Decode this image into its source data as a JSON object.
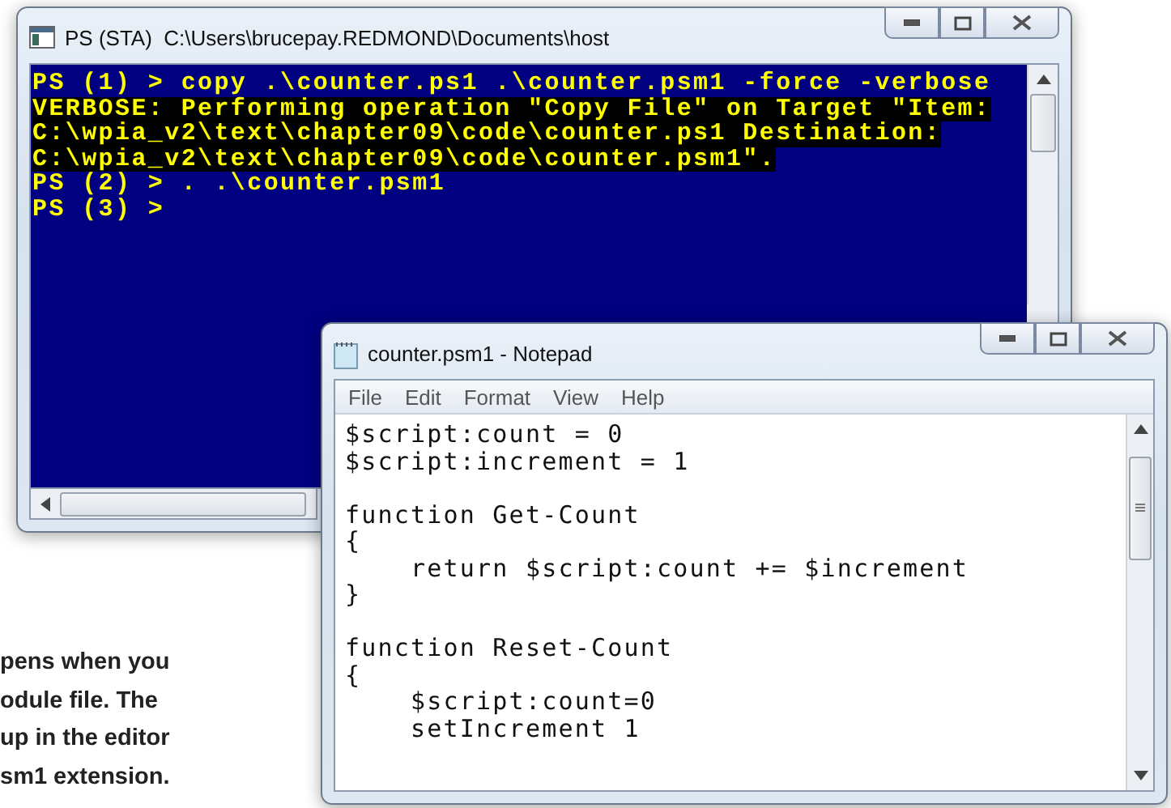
{
  "console_window": {
    "title": "PS (STA)  C:\\Users\\brucepay.REDMOND\\Documents\\host",
    "lines": [
      {
        "text": "PS (1) > copy .\\counter.ps1 .\\counter.psm1 -force -verbose",
        "kind": "prompt"
      },
      {
        "text": "VERBOSE: Performing operation \"Copy File\" on Target \"Item:",
        "kind": "verbose"
      },
      {
        "text": "C:\\wpia_v2\\text\\chapter09\\code\\counter.ps1 Destination:",
        "kind": "verbose"
      },
      {
        "text": "C:\\wpia_v2\\text\\chapter09\\code\\counter.psm1\".",
        "kind": "verbose"
      },
      {
        "text": "PS (2) > . .\\counter.psm1",
        "kind": "prompt"
      },
      {
        "text": "PS (3) >",
        "kind": "prompt"
      }
    ]
  },
  "notepad_window": {
    "title": "counter.psm1 - Notepad",
    "menu": [
      "File",
      "Edit",
      "Format",
      "View",
      "Help"
    ],
    "blocks": [
      [
        "$script:count = 0",
        "$script:increment = 1"
      ],
      [
        "function Get-Count",
        "{",
        "    return $script:count += $increment",
        "}"
      ],
      [
        "function Reset-Count",
        "{",
        "    $script:count=0",
        "    setIncrement 1"
      ]
    ]
  },
  "caption": {
    "lines": [
      "pens when you",
      "odule file. The",
      "up in the editor",
      "sm1 extension."
    ]
  }
}
